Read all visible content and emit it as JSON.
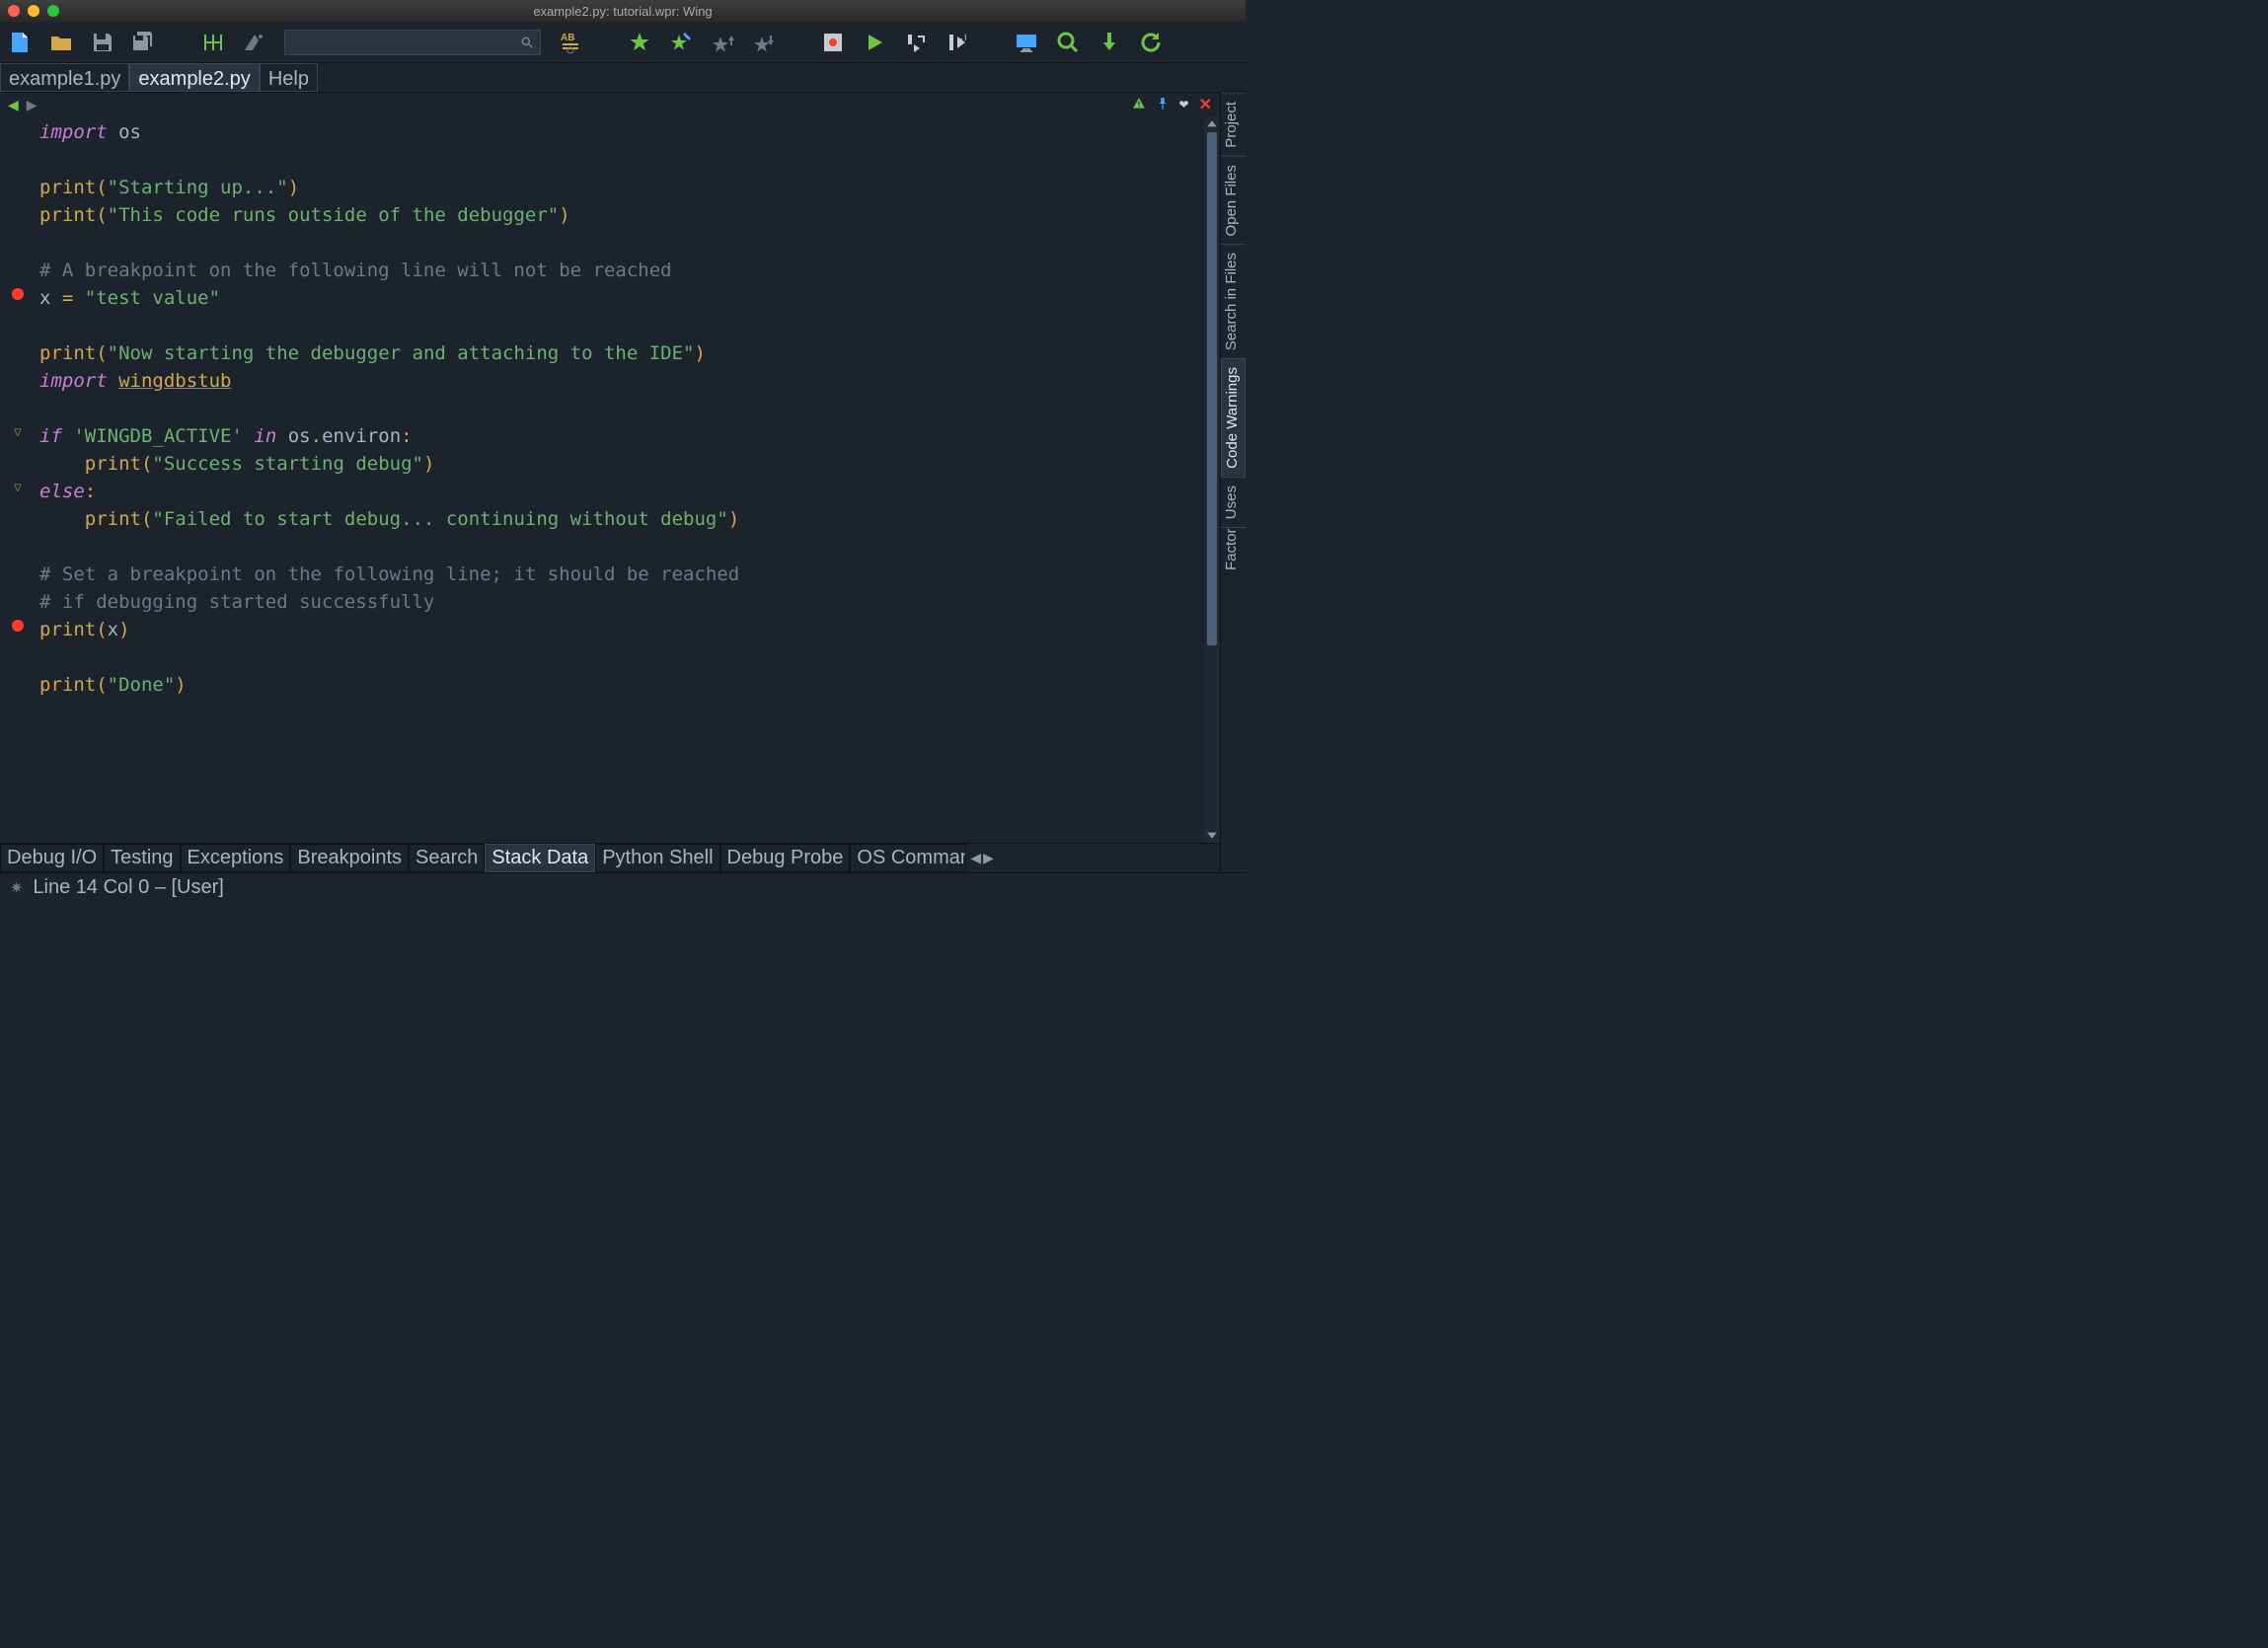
{
  "window": {
    "title": "example2.py: tutorial.wpr: Wing"
  },
  "traffic_colors": {
    "close": "#ff5f57",
    "min": "#ffbd2e",
    "max": "#28c940"
  },
  "editor_tabs": [
    {
      "label": "example1.py",
      "active": false
    },
    {
      "label": "example2.py",
      "active": true
    },
    {
      "label": "Help",
      "active": false
    }
  ],
  "side_tabs": [
    {
      "label": "Project",
      "active": false
    },
    {
      "label": "Open Files",
      "active": false
    },
    {
      "label": "Search in Files",
      "active": false
    },
    {
      "label": "Code Warnings",
      "active": true
    },
    {
      "label": "Uses",
      "active": false
    },
    {
      "label": "Factoring",
      "active": false,
      "clipped": true
    }
  ],
  "bottom_tabs": [
    {
      "label": "Debug I/O",
      "active": false
    },
    {
      "label": "Testing",
      "active": false
    },
    {
      "label": "Exceptions",
      "active": false
    },
    {
      "label": "Breakpoints",
      "active": false
    },
    {
      "label": "Search",
      "active": false
    },
    {
      "label": "Stack Data",
      "active": true
    },
    {
      "label": "Python Shell",
      "active": false
    },
    {
      "label": "Debug Probe",
      "active": false
    },
    {
      "label": "OS Commands",
      "active": false,
      "clipped": true
    }
  ],
  "status": {
    "text": "Line 14 Col 0 – [User]"
  },
  "breakpoints_at_lines": [
    6,
    18
  ],
  "folds_at_lines": [
    11,
    13
  ],
  "code_lines": [
    [
      [
        "kw",
        "import"
      ],
      [
        "sp",
        " "
      ],
      [
        "id",
        "os"
      ]
    ],
    [],
    [
      [
        "fn",
        "print"
      ],
      [
        "pn",
        "("
      ],
      [
        "str",
        "\"Starting up...\""
      ],
      [
        "pn",
        ")"
      ]
    ],
    [
      [
        "fn",
        "print"
      ],
      [
        "pn",
        "("
      ],
      [
        "str",
        "\"This code runs outside of the debugger\""
      ],
      [
        "pn",
        ")"
      ]
    ],
    [],
    [
      [
        "cm",
        "# A breakpoint on the following line will not be reached"
      ]
    ],
    [
      [
        "id",
        "x "
      ],
      [
        "pn",
        "="
      ],
      [
        "id",
        " "
      ],
      [
        "str",
        "\"test value\""
      ]
    ],
    [],
    [
      [
        "fn",
        "print"
      ],
      [
        "pn",
        "("
      ],
      [
        "str",
        "\"Now starting the debugger and attaching to the IDE\""
      ],
      [
        "pn",
        ")"
      ]
    ],
    [
      [
        "kw",
        "import"
      ],
      [
        "sp",
        " "
      ],
      [
        "mod",
        "wingdbstub"
      ]
    ],
    [],
    [
      [
        "kw",
        "if"
      ],
      [
        "id",
        " "
      ],
      [
        "str",
        "'WINGDB_ACTIVE'"
      ],
      [
        "id",
        " "
      ],
      [
        "kw",
        "in"
      ],
      [
        "id",
        " os"
      ],
      [
        "pn",
        "."
      ],
      [
        "id",
        "environ"
      ],
      [
        "pn",
        ":"
      ]
    ],
    [
      [
        "sp",
        "    "
      ],
      [
        "fn",
        "print"
      ],
      [
        "pn",
        "("
      ],
      [
        "str",
        "\"Success starting debug\""
      ],
      [
        "pn",
        ")"
      ]
    ],
    [
      [
        "kw",
        "else"
      ],
      [
        "pn",
        ":"
      ]
    ],
    [
      [
        "sp",
        "    "
      ],
      [
        "fn",
        "print"
      ],
      [
        "pn",
        "("
      ],
      [
        "str",
        "\"Failed to start debug... continuing without debug\""
      ],
      [
        "pn",
        ")"
      ]
    ],
    [],
    [
      [
        "cm",
        "# Set a breakpoint on the following line; it should be reached"
      ]
    ],
    [
      [
        "cm",
        "# if debugging started successfully"
      ]
    ],
    [
      [
        "fn",
        "print"
      ],
      [
        "pn",
        "("
      ],
      [
        "id",
        "x"
      ],
      [
        "pn",
        ")"
      ]
    ],
    [],
    [
      [
        "fn",
        "print"
      ],
      [
        "pn",
        "("
      ],
      [
        "str",
        "\"Done\""
      ],
      [
        "pn",
        ")"
      ]
    ],
    [],
    []
  ]
}
